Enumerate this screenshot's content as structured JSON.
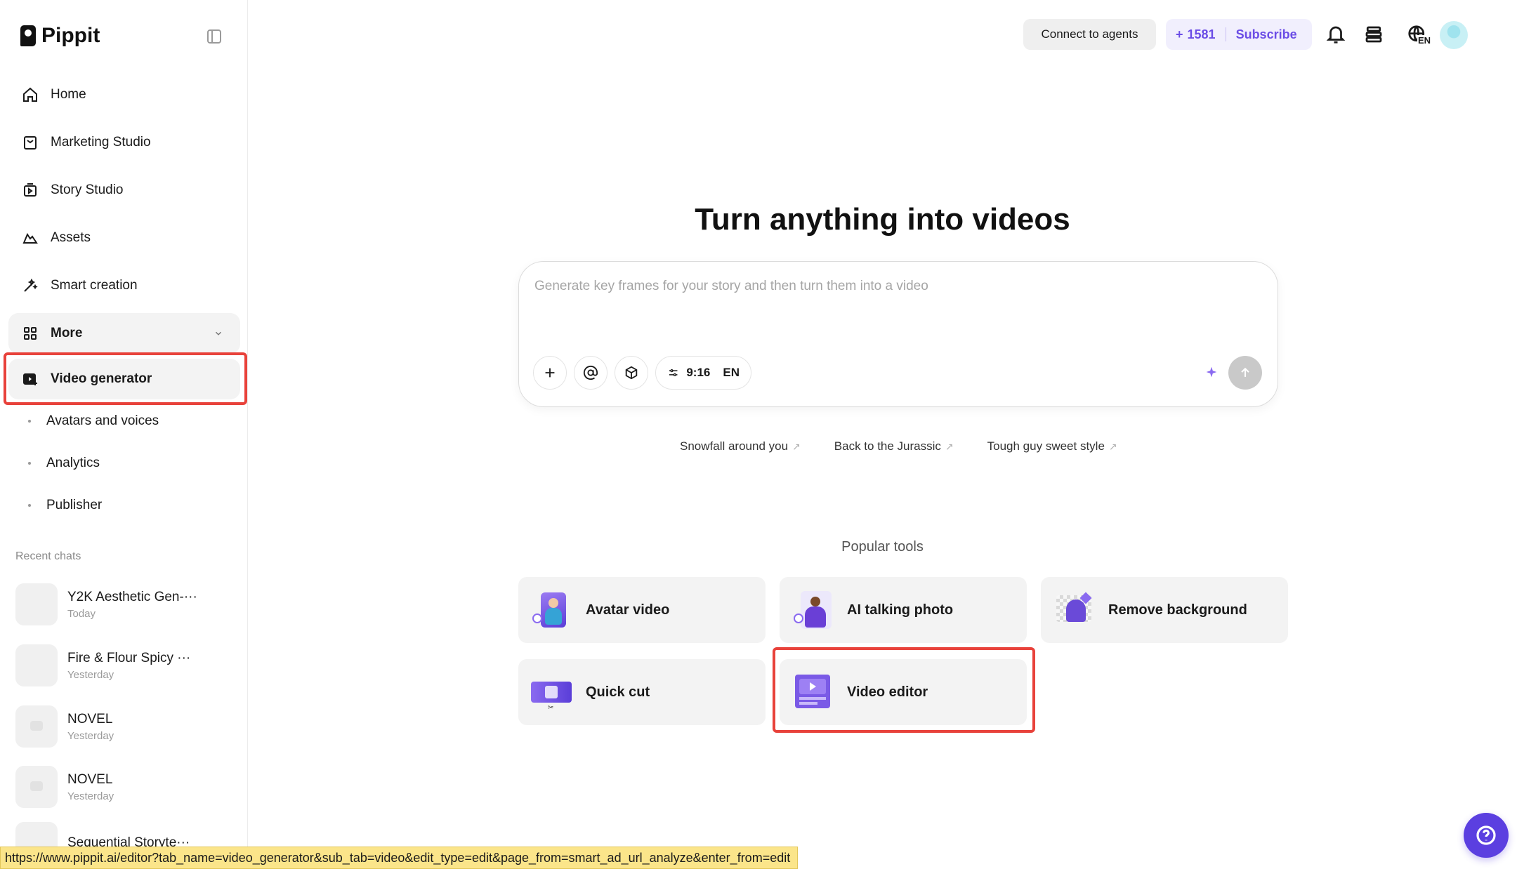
{
  "app": {
    "name": "Pippit"
  },
  "sidebar": {
    "items": [
      {
        "label": "Home",
        "icon": "home-icon"
      },
      {
        "label": "Marketing Studio",
        "icon": "calendar-icon"
      },
      {
        "label": "Story Studio",
        "icon": "film-icon"
      },
      {
        "label": "Assets",
        "icon": "cloud-icon"
      },
      {
        "label": "Smart creation",
        "icon": "magic-wand-icon"
      }
    ],
    "more_label": "More",
    "active_label": "Video generator",
    "sub_items": [
      "Avatars and voices",
      "Analytics",
      "Publisher"
    ],
    "recent_title": "Recent chats",
    "recent_chats": [
      {
        "title": "Y2K Aesthetic Gen-···",
        "time": "Today"
      },
      {
        "title": "Fire & Flour Spicy ···",
        "time": "Yesterday"
      },
      {
        "title": "NOVEL",
        "time": "Yesterday"
      },
      {
        "title": "NOVEL",
        "time": "Yesterday"
      },
      {
        "title": "Sequential Storyte···",
        "time": ""
      }
    ]
  },
  "topbar": {
    "connect_label": "Connect to agents",
    "credits_prefix": "+",
    "credits": "1581",
    "subscribe_label": "Subscribe",
    "lang_badge": "EN"
  },
  "hero": {
    "title": "Turn anything into videos",
    "placeholder": "Generate key frames for your story and then turn them into a video",
    "ratio": "9:16",
    "lang": "EN",
    "suggestions": [
      "Snowfall around you",
      "Back to the Jurassic",
      "Tough guy sweet style"
    ]
  },
  "popular": {
    "title": "Popular tools",
    "tools": [
      {
        "label": "Avatar video"
      },
      {
        "label": "AI talking photo"
      },
      {
        "label": "Remove background"
      },
      {
        "label": "Quick cut"
      },
      {
        "label": "Video editor"
      }
    ]
  },
  "status_url": "https://www.pippit.ai/editor?tab_name=video_generator&sub_tab=video&edit_type=edit&page_from=smart_ad_url_analyze&enter_from=edit",
  "colors": {
    "accent": "#6b4de6",
    "highlight": "#e8423b",
    "help": "#5b3fe0"
  }
}
